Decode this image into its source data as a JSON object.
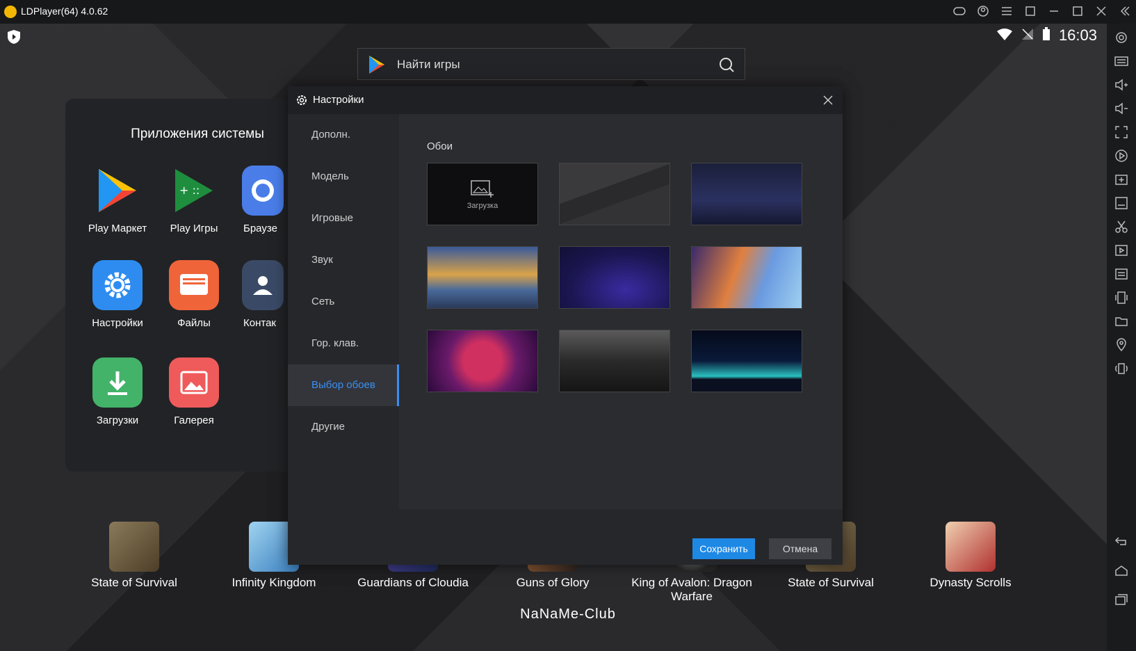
{
  "window": {
    "title": "LDPlayer(64) 4.0.62"
  },
  "status": {
    "time": "16:03"
  },
  "search": {
    "placeholder": "Найти игры"
  },
  "system_apps": {
    "title": "Приложения системы",
    "items": [
      {
        "label": "Play Маркет"
      },
      {
        "label": "Play Игры"
      },
      {
        "label": "Браузе"
      },
      {
        "label": "Настройки"
      },
      {
        "label": "Файлы"
      },
      {
        "label": "Контак"
      },
      {
        "label": "Загрузки"
      },
      {
        "label": "Галерея"
      }
    ]
  },
  "games": [
    {
      "label": "State of Survival"
    },
    {
      "label": "Infinity Kingdom"
    },
    {
      "label": "Guardians of Cloudia"
    },
    {
      "label": "Guns of Glory"
    },
    {
      "label": "King of Avalon: Dragon Warfare"
    },
    {
      "label": "State of Survival"
    },
    {
      "label": "Dynasty Scrolls"
    }
  ],
  "watermark": "NaNaMe-Club",
  "dialog": {
    "title": "Настройки",
    "nav": [
      {
        "label": "Дополн."
      },
      {
        "label": "Модель"
      },
      {
        "label": "Игровые"
      },
      {
        "label": "Звук"
      },
      {
        "label": "Сеть"
      },
      {
        "label": "Гор. клав."
      },
      {
        "label": "Выбор обоев",
        "active": true
      },
      {
        "label": "Другие"
      }
    ],
    "section_title": "Обои",
    "upload_label": "Загрузка",
    "save_label": "Сохранить",
    "cancel_label": "Отмена"
  },
  "colors": {
    "accent": "#1e88e5",
    "active_nav": "#3b8ff0"
  }
}
